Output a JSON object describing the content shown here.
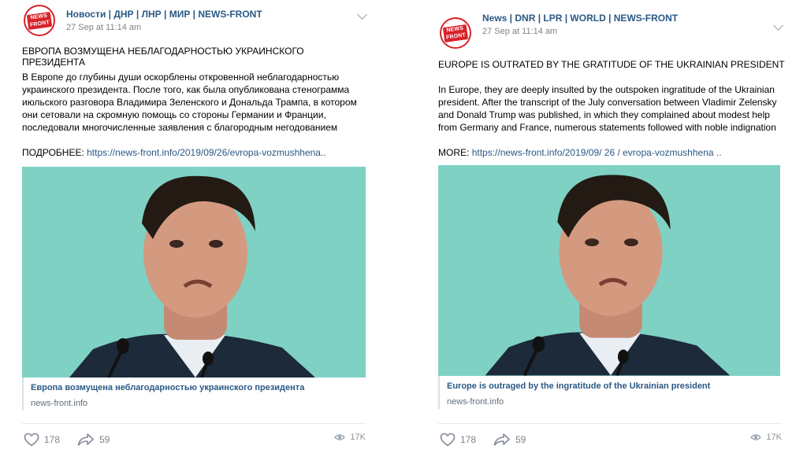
{
  "posts": [
    {
      "avatar_text": [
        "NEWS",
        "FRONT"
      ],
      "source": "Новости | ДНР | ЛНР | МИР | NEWS-FRONT",
      "time": "27 Sep at 11:14 am",
      "headline": "ЕВРОПА ВОЗМУЩЕНА НЕБЛАГОДАРНОСТЬЮ УКРАИНСКОГО ПРЕЗИДЕНТА",
      "body": "В Европе до глубины души оскорблены откровенной неблагодарностью украинского президента. После того, как была опубликована стенограмма июльского разговора Владимира Зеленского и Дональда Трампа, в котором они сетовали на скромную помощь со стороны Германии и Франции, последовали многочисленные заявления с благородным негодованием",
      "more_label": "ПОДРОБНЕЕ:",
      "more_link": "https://news-front.info/2019/09/26/evropa-vozmushhena..",
      "link_title": "Европа возмущена неблагодарностью украинского президента",
      "link_domain": "news-front.info",
      "likes": "178",
      "shares": "59",
      "views": "17K"
    },
    {
      "avatar_text": [
        "NEWS",
        "FRONT"
      ],
      "source": "News | DNR | LPR | WORLD | NEWS-FRONT",
      "time": "27 Sep at 11:14 am",
      "headline": "EUROPE IS OUTRATED BY THE GRATITUDE OF THE UKRAINIAN PRESIDENT",
      "body": "In Europe, they are deeply insulted by the outspoken ingratitude of the Ukrainian president. After the transcript of the July conversation between Vladimir Zelensky and Donald Trump was published, in which they complained about modest help from Germany and France, numerous statements followed with noble indignation",
      "more_label": "MORE:",
      "more_link": "https://news-front.info/2019/09/ 26 / evropa-vozmushhena ..",
      "link_title": "Europe is outraged by the ingratitude of the Ukrainian president",
      "link_domain": "news-front.info",
      "likes": "178",
      "shares": "59",
      "views": "17K"
    }
  ],
  "colors": {
    "link": "#2a5885",
    "muted": "#828282",
    "brand_red": "#d8232a",
    "photo_bg": "#7fd1c4"
  },
  "icons": [
    "menu-chevron-icon",
    "heart-icon",
    "share-arrow-icon",
    "eye-icon"
  ]
}
